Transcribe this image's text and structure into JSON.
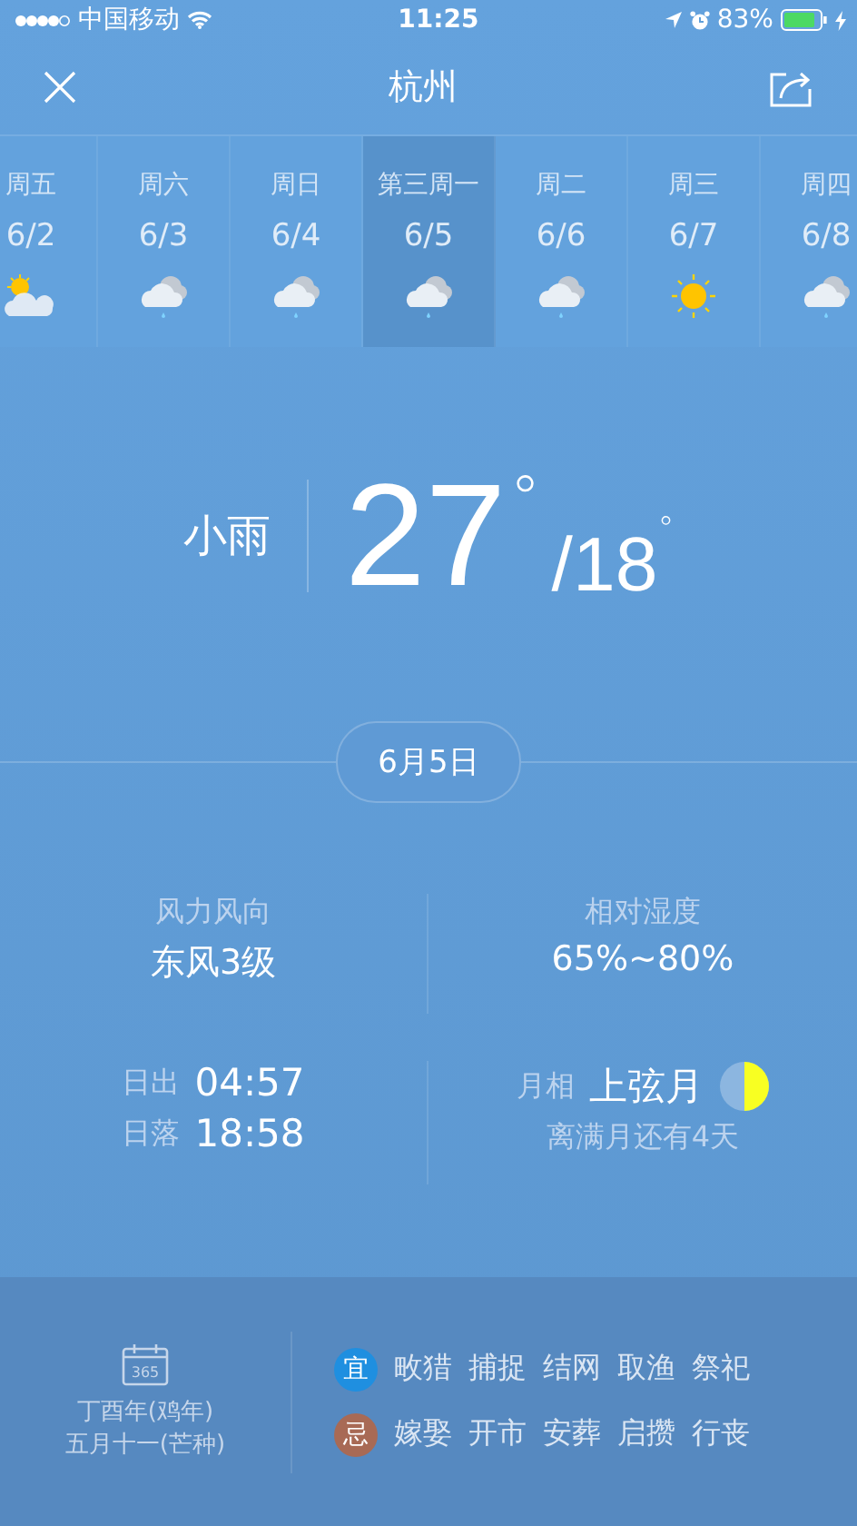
{
  "status_bar": {
    "carrier": "中国移动",
    "time": "11:25",
    "battery": "83%"
  },
  "header": {
    "title": "杭州"
  },
  "days": [
    {
      "weekday": "周五",
      "date": "6/2",
      "kind": "partly_cloudy",
      "selected": false
    },
    {
      "weekday": "周六",
      "date": "6/3",
      "kind": "rain",
      "selected": false
    },
    {
      "weekday": "周日",
      "date": "6/4",
      "kind": "rain",
      "selected": false
    },
    {
      "weekday": "第三周一",
      "date": "6/5",
      "kind": "rain",
      "selected": true
    },
    {
      "weekday": "周二",
      "date": "6/6",
      "kind": "rain",
      "selected": false
    },
    {
      "weekday": "周三",
      "date": "6/7",
      "kind": "sunny",
      "selected": false
    },
    {
      "weekday": "周四",
      "date": "6/8",
      "kind": "rain",
      "selected": false
    }
  ],
  "today": {
    "condition": "小雨",
    "high": "27",
    "high_unit": "°",
    "low": "/18",
    "low_unit": "°",
    "date": "6月5日"
  },
  "details": {
    "wind_label": "风力风向",
    "wind": "东风3级",
    "humidity_label": "相对湿度",
    "humidity": "65%~80%",
    "sunrise_label": "日出",
    "sunrise": "04:57",
    "sunset_label": "日落",
    "sunset": "18:58",
    "moon_label": "月相",
    "moon_phase": "上弦月",
    "moon_note": "离满月还有4天"
  },
  "almanac": {
    "calendar_icon_text": "365",
    "year": "丁酉年(鸡年)",
    "lunar_date": "五月十一(芒种)",
    "rows": [
      {
        "badge": "宜",
        "color": "#1f8fe0",
        "items": [
          "畋猎",
          "捕捉",
          "结网",
          "取渔",
          "祭祀"
        ]
      },
      {
        "badge": "忌",
        "color": "#a86a55",
        "items": [
          "嫁娶",
          "开市",
          "安葬",
          "启攒",
          "行丧"
        ]
      }
    ]
  }
}
